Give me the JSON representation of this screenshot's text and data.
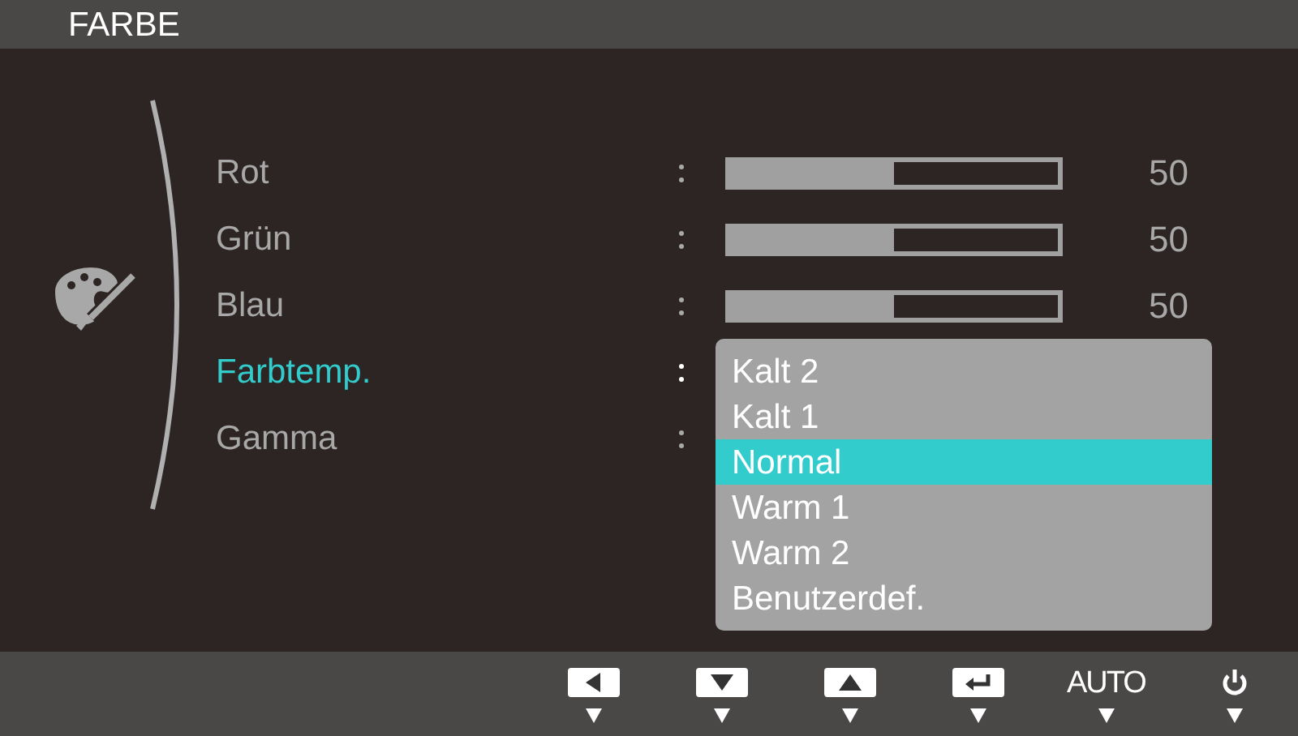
{
  "title": "FARBE",
  "menu": [
    {
      "label": "Rot",
      "selected": false,
      "kind": "slider",
      "level": 0.5,
      "value": "50"
    },
    {
      "label": "Grün",
      "selected": false,
      "kind": "slider",
      "level": 0.5,
      "value": "50"
    },
    {
      "label": "Blau",
      "selected": false,
      "kind": "slider",
      "level": 0.5,
      "value": "50"
    },
    {
      "label": "Farbtemp.",
      "selected": true,
      "kind": "select"
    },
    {
      "label": "Gamma",
      "selected": false,
      "kind": "select"
    }
  ],
  "dropdown": [
    {
      "label": "Kalt 2",
      "selected": false
    },
    {
      "label": "Kalt 1",
      "selected": false
    },
    {
      "label": "Normal",
      "selected": true
    },
    {
      "label": "Warm 1",
      "selected": false
    },
    {
      "label": "Warm 2",
      "selected": false
    },
    {
      "label": "Benutzerdef.",
      "selected": false
    }
  ],
  "buttons": [
    {
      "kind": "left"
    },
    {
      "kind": "down"
    },
    {
      "kind": "up"
    },
    {
      "kind": "enter"
    },
    {
      "kind": "text",
      "label": "AUTO"
    },
    {
      "kind": "power"
    }
  ]
}
